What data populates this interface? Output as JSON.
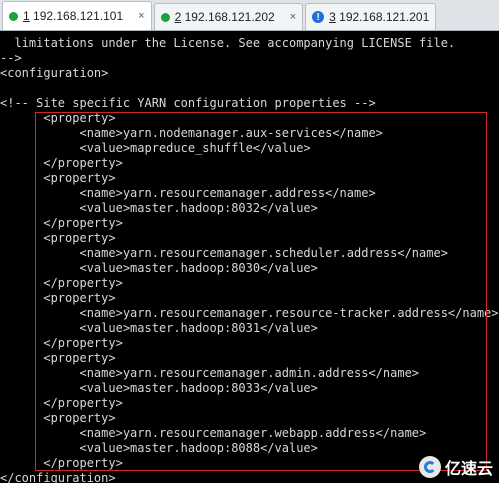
{
  "tabs": [
    {
      "num": "1",
      "host": "192.168.121.101",
      "status": "connected",
      "active": true
    },
    {
      "num": "2",
      "host": "192.168.121.202",
      "status": "connected",
      "active": false
    },
    {
      "num": "3",
      "host": "192.168.121.201",
      "status": "warning",
      "active": false
    }
  ],
  "close_glyph": "×",
  "warning_glyph": "!",
  "terminal_lines": [
    "  limitations under the License. See accompanying LICENSE file.",
    "-->",
    "<configuration>",
    "",
    "<!-- Site specific YARN configuration properties -->",
    "      <property>",
    "           <name>yarn.nodemanager.aux-services</name>",
    "           <value>mapreduce_shuffle</value>",
    "      </property>",
    "      <property>",
    "           <name>yarn.resourcemanager.address</name>",
    "           <value>master.hadoop:8032</value>",
    "      </property>",
    "      <property>",
    "           <name>yarn.resourcemanager.scheduler.address</name>",
    "           <value>master.hadoop:8030</value>",
    "      </property>",
    "      <property>",
    "           <name>yarn.resourcemanager.resource-tracker.address</name>",
    "           <value>master.hadoop:8031</value>",
    "      </property>",
    "      <property>",
    "           <name>yarn.resourcemanager.admin.address</name>",
    "           <value>master.hadoop:8033</value>",
    "      </property>",
    "      <property>",
    "           <name>yarn.resourcemanager.webapp.address</name>",
    "           <value>master.hadoop:8088</value>",
    "      </property>",
    "</configuration>"
  ],
  "watermark": {
    "text": "亿速云"
  },
  "colors": {
    "connected": "#1aa33b",
    "warning": "#1f6fd6",
    "highlight_box": "#d02828"
  }
}
